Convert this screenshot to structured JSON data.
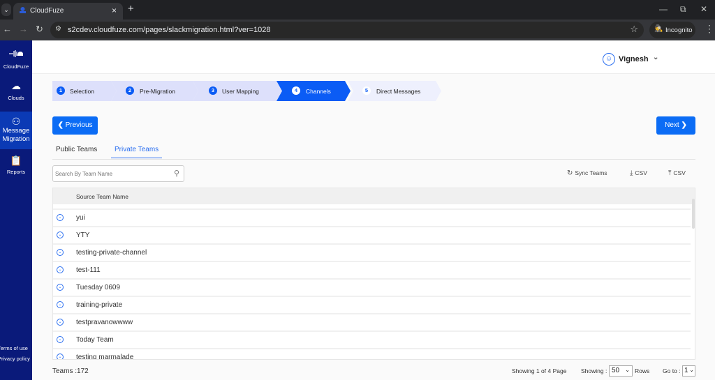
{
  "browser": {
    "tab_title": "CloudFuze",
    "url": "s2cdev.cloudfuze.com/pages/slackmigration.html?ver=1028",
    "incognito_label": "Incognito"
  },
  "sidebar": {
    "brand": "CloudFuze",
    "items": [
      {
        "label": "Clouds",
        "icon": "cloud-icon"
      },
      {
        "label": "Message Migration",
        "icon": "users-icon"
      },
      {
        "label": "Reports",
        "icon": "clipboard-icon"
      }
    ],
    "footer_links": [
      "Terms of use",
      "Privacy policy"
    ]
  },
  "header": {
    "user_name": "Vignesh"
  },
  "stepper": [
    {
      "num": "1",
      "label": "Selection",
      "state": "done"
    },
    {
      "num": "2",
      "label": "Pre-Migration",
      "state": "done"
    },
    {
      "num": "3",
      "label": "User Mapping",
      "state": "done"
    },
    {
      "num": "4",
      "label": "Channels",
      "state": "active"
    },
    {
      "num": "5",
      "label": "Direct Messages",
      "state": "future"
    }
  ],
  "buttons": {
    "previous": "Previous",
    "next": "Next"
  },
  "tabs": [
    {
      "label": "Public Teams",
      "active": false
    },
    {
      "label": "Private Teams",
      "active": true
    }
  ],
  "search": {
    "placeholder": "Search By Team Name",
    "value": ""
  },
  "toolbar": {
    "sync": "Sync Teams",
    "download_csv": "CSV",
    "upload_csv": "CSV"
  },
  "table": {
    "column": "Source Team Name",
    "rows": [
      "yui",
      "YTY",
      "testing-private-channel",
      "test-111",
      "Tuesday 0609",
      "training-private",
      "testpravanowwww",
      "Today Team",
      "testing marmalade"
    ]
  },
  "footer": {
    "teams_count": "Teams :172",
    "page_info": "Showing 1 of 4 Page",
    "showing_label": "Showing :",
    "rows_value": "50",
    "rows_label": "Rows",
    "goto_label": "Go to :",
    "goto_value": "1"
  },
  "colors": {
    "accent": "#0b6cf5",
    "sidebar": "#0a1a7a",
    "sidebar_active": "#0b3ab5",
    "step_done": "#dde0fb",
    "step_future": "#eef0fd"
  }
}
